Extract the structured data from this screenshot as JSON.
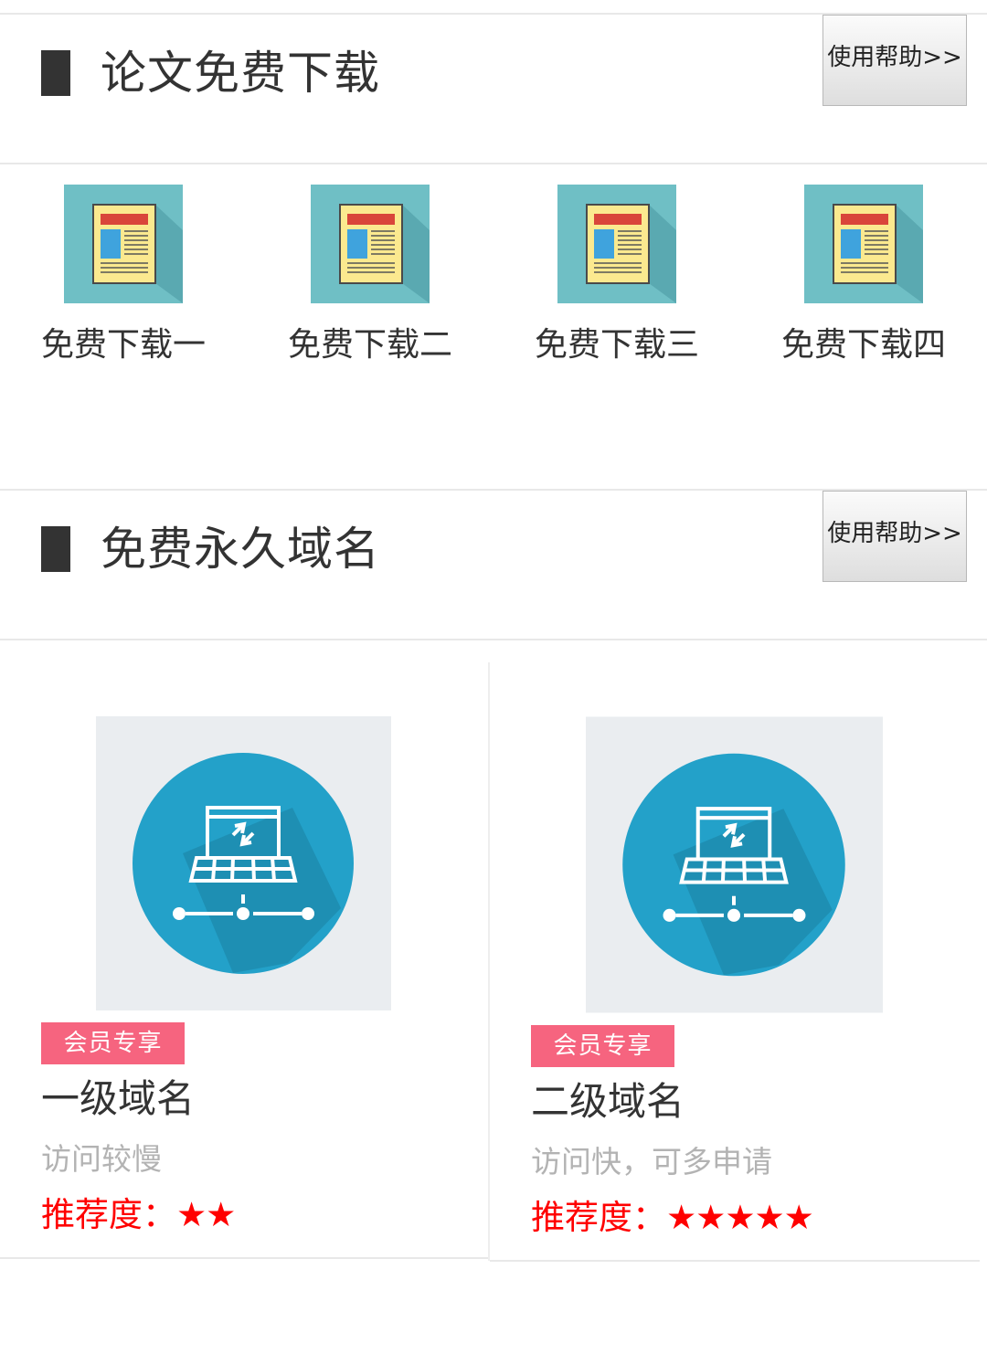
{
  "paper_section": {
    "title": "论文免费下载",
    "help_label": "使用帮助>>",
    "items": [
      {
        "label": "免费下载一"
      },
      {
        "label": "免费下载二"
      },
      {
        "label": "免费下载三"
      },
      {
        "label": "免费下载四"
      }
    ]
  },
  "domain_section": {
    "title": "免费永久域名",
    "help_label": "使用帮助>>",
    "cards": [
      {
        "badge": "会员专享",
        "title": "一级域名",
        "description": "访问较慢",
        "rating_label": "推荐度：",
        "stars": "★★"
      },
      {
        "badge": "会员专享",
        "title": "二级域名",
        "description": "访问快，可多申请",
        "rating_label": "推荐度：",
        "stars": "★★★★★"
      }
    ]
  },
  "colors": {
    "badge": "#f6647f",
    "rating": "#ff0000",
    "paper_icon_bg": "#6fbfc5",
    "network_icon_circle": "#23a1c9"
  }
}
